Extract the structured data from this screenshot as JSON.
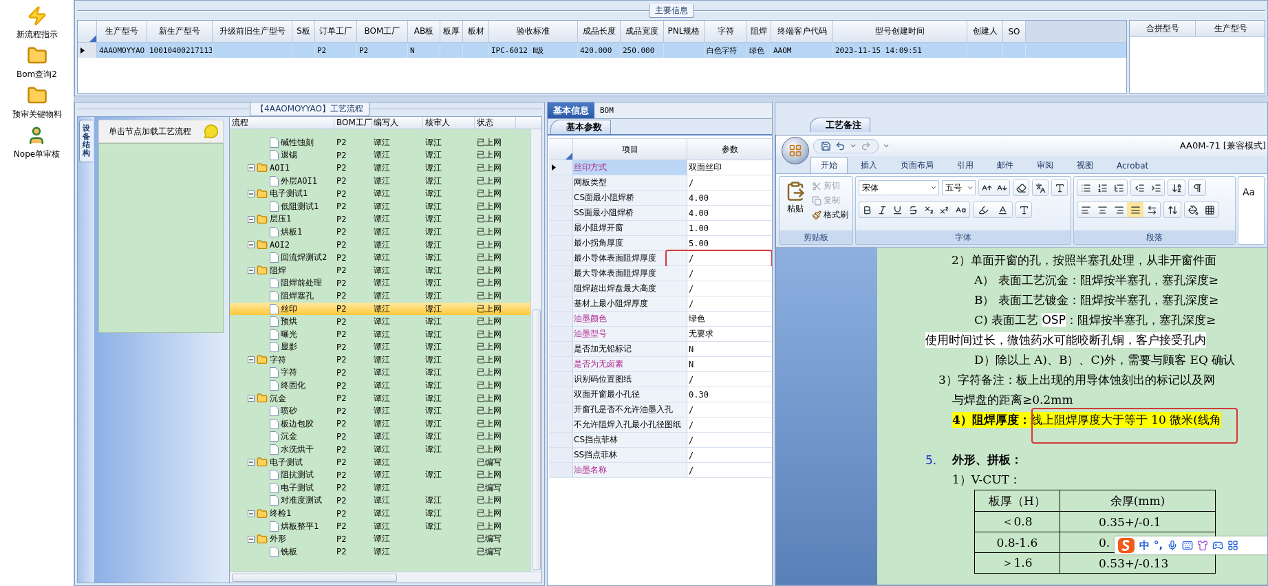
{
  "sidebar": {
    "items": [
      {
        "kind": "bolt",
        "label": "新流程指示"
      },
      {
        "kind": "folder",
        "label": "Bom查询2"
      },
      {
        "kind": "folder",
        "label": "预审关键物料"
      },
      {
        "kind": "person",
        "label": "Nope单审核"
      }
    ]
  },
  "main_info": {
    "title": "主要信息",
    "columns": [
      "生产型号",
      "新生产型号",
      "升级前旧生产型号",
      "S板",
      "订单工厂",
      "BOM工厂",
      "AB板",
      "板厚",
      "板材",
      "验收标准",
      "成品长度",
      "成品宽度",
      "PNL规格",
      "字符",
      "阻焊",
      "终端客户代码",
      "型号创建时间",
      "创建人",
      "SO"
    ],
    "rows": [
      {
        "selected": true,
        "cells": [
          "4AAOMOYYAO",
          "10010400217113",
          "",
          "",
          "P2",
          "P2",
          "N",
          "",
          "",
          "IPC-6012 Ⅱ级",
          "420.000",
          "250.000",
          "",
          "白色字符",
          "绿色",
          "AAOM",
          "2023-11-15 14:09:51",
          "",
          ""
        ]
      }
    ]
  },
  "merge_grid": {
    "columns": [
      "合拼型号",
      "生产型号"
    ]
  },
  "process": {
    "title": "【4AAOMOYYAO】工艺流程",
    "side_tab": "设备结构",
    "hint": "单击节点加载工艺流程",
    "columns": [
      "流程",
      "BOM工厂",
      "编写人",
      "核审人",
      "状态"
    ],
    "nodes": [
      {
        "children": [
          {
            "label": "碱性蚀刻",
            "bom": "P2",
            "writer": "谭江",
            "reviewer": "谭江",
            "status": "已上网",
            "selected": false
          },
          {
            "label": "退锡",
            "bom": "P2",
            "writer": "谭江",
            "reviewer": "谭江",
            "status": "已上网",
            "selected": false
          }
        ]
      },
      {
        "label": "AOI1",
        "bom": "P2",
        "writer": "谭江",
        "reviewer": "谭江",
        "status": "已上网",
        "selected": false,
        "expanded": true,
        "children": [
          {
            "label": "外层AOI1",
            "bom": "P2",
            "writer": "谭江",
            "reviewer": "谭江",
            "status": "已上网",
            "selected": false
          }
        ]
      },
      {
        "label": "电子测试1",
        "bom": "P2",
        "writer": "谭江",
        "reviewer": "谭江",
        "status": "已上网",
        "selected": false,
        "expanded": true,
        "children": [
          {
            "label": "低阻测试1",
            "bom": "P2",
            "writer": "谭江",
            "reviewer": "谭江",
            "status": "已上网",
            "selected": false
          }
        ]
      },
      {
        "label": "层压1",
        "bom": "P2",
        "writer": "谭江",
        "reviewer": "谭江",
        "status": "已上网",
        "selected": false,
        "expanded": true,
        "children": [
          {
            "label": "烘板1",
            "bom": "P2",
            "writer": "谭江",
            "reviewer": "谭江",
            "status": "已上网",
            "selected": false
          }
        ]
      },
      {
        "label": "AOI2",
        "bom": "P2",
        "writer": "谭江",
        "reviewer": "谭江",
        "status": "已上网",
        "selected": false,
        "expanded": true,
        "children": [
          {
            "label": "回流焊测试2",
            "bom": "P2",
            "writer": "谭江",
            "reviewer": "谭江",
            "status": "已上网",
            "selected": false
          }
        ]
      },
      {
        "label": "阻焊",
        "bom": "P2",
        "writer": "谭江",
        "reviewer": "谭江",
        "status": "已上网",
        "selected": false,
        "expanded": true,
        "children": [
          {
            "label": "阻焊前处理",
            "bom": "P2",
            "writer": "谭江",
            "reviewer": "谭江",
            "status": "已上网",
            "selected": false
          },
          {
            "label": "阻焊塞孔",
            "bom": "P2",
            "writer": "谭江",
            "reviewer": "谭江",
            "status": "已上网",
            "selected": false
          },
          {
            "label": "丝印",
            "bom": "P2",
            "writer": "谭江",
            "reviewer": "谭江",
            "status": "已上网",
            "selected": true
          },
          {
            "label": "预烘",
            "bom": "P2",
            "writer": "谭江",
            "reviewer": "谭江",
            "status": "已上网",
            "selected": false
          },
          {
            "label": "曝光",
            "bom": "P2",
            "writer": "谭江",
            "reviewer": "谭江",
            "status": "已上网",
            "selected": false
          },
          {
            "label": "显影",
            "bom": "P2",
            "writer": "谭江",
            "reviewer": "谭江",
            "status": "已上网",
            "selected": false
          }
        ]
      },
      {
        "label": "字符",
        "bom": "P2",
        "writer": "谭江",
        "reviewer": "谭江",
        "status": "已上网",
        "selected": false,
        "expanded": true,
        "children": [
          {
            "label": "字符",
            "bom": "P2",
            "writer": "谭江",
            "reviewer": "谭江",
            "status": "已上网",
            "selected": false
          },
          {
            "label": "终固化",
            "bom": "P2",
            "writer": "谭江",
            "reviewer": "谭江",
            "status": "已上网",
            "selected": false
          }
        ]
      },
      {
        "label": "沉金",
        "bom": "P2",
        "writer": "谭江",
        "reviewer": "谭江",
        "status": "已上网",
        "selected": false,
        "expanded": true,
        "children": [
          {
            "label": "喷砂",
            "bom": "P2",
            "writer": "谭江",
            "reviewer": "谭江",
            "status": "已上网",
            "selected": false
          },
          {
            "label": "板边包胶",
            "bom": "P2",
            "writer": "谭江",
            "reviewer": "谭江",
            "status": "已上网",
            "selected": false
          },
          {
            "label": "沉金",
            "bom": "P2",
            "writer": "谭江",
            "reviewer": "谭江",
            "status": "已上网",
            "selected": false
          },
          {
            "label": "水洗烘干",
            "bom": "P2",
            "writer": "谭江",
            "reviewer": "谭江",
            "status": "已上网",
            "selected": false
          }
        ]
      },
      {
        "label": "电子测试",
        "bom": "P2",
        "writer": "谭江",
        "status": "已编写",
        "selected": false,
        "expanded": true,
        "children": [
          {
            "label": "阻抗测试",
            "bom": "P2",
            "writer": "谭江",
            "reviewer": "谭江",
            "status": "已上网",
            "selected": false
          },
          {
            "label": "电子测试",
            "bom": "P2",
            "writer": "谭江",
            "status": "已编写",
            "selected": false
          },
          {
            "label": "对准度测试",
            "bom": "P2",
            "writer": "谭江",
            "reviewer": "谭江",
            "status": "已上网",
            "selected": false
          }
        ]
      },
      {
        "label": "终检1",
        "bom": "P2",
        "writer": "谭江",
        "reviewer": "谭江",
        "status": "已上网",
        "selected": false,
        "expanded": true,
        "children": [
          {
            "label": "烘板整平1",
            "bom": "P2",
            "writer": "谭江",
            "reviewer": "谭江",
            "status": "已上网",
            "selected": false
          }
        ]
      },
      {
        "label": "外形",
        "bom": "P2",
        "writer": "谭江",
        "status": "已编写",
        "selected": false,
        "expanded": true,
        "children": [
          {
            "label": "铣板",
            "bom": "P2",
            "writer": "谭江",
            "status": "已编写",
            "selected": false
          }
        ]
      }
    ]
  },
  "params": {
    "tabs": [
      {
        "label": "基本信息",
        "selected": true
      },
      {
        "label": "BOM",
        "selected": false
      }
    ],
    "subtab": "基本参数",
    "columns": [
      "项目",
      "参数"
    ],
    "rows": [
      {
        "label": "丝印方式",
        "value": "双面丝印",
        "emphasis": true,
        "selected": true,
        "flagged": false
      },
      {
        "label": "网板类型",
        "value": "/",
        "emphasis": false,
        "selected": false,
        "flagged": false
      },
      {
        "label": "CS面最小阻焊桥",
        "value": "4.00",
        "emphasis": false,
        "selected": false,
        "flagged": false
      },
      {
        "label": "SS面最小阻焊桥",
        "value": "4.00",
        "emphasis": false,
        "selected": false,
        "flagged": false
      },
      {
        "label": "最小阻焊开窗",
        "value": "1.00",
        "emphasis": false,
        "selected": false,
        "flagged": false
      },
      {
        "label": "最小拐角厚度",
        "value": "5.00",
        "emphasis": false,
        "selected": false,
        "flagged": false
      },
      {
        "label": "最小导体表面阻焊厚度",
        "value": "/",
        "emphasis": false,
        "selected": false,
        "flagged": true
      },
      {
        "label": "最大导体表面阻焊厚度",
        "value": "/",
        "emphasis": false,
        "selected": false,
        "flagged": false
      },
      {
        "label": "阻焊超出焊盘最大高度",
        "value": "/",
        "emphasis": false,
        "selected": false,
        "flagged": false
      },
      {
        "label": "基材上最小阻焊厚度",
        "value": "/",
        "emphasis": false,
        "selected": false,
        "flagged": false
      },
      {
        "label": "油墨颜色",
        "value": "绿色",
        "emphasis": true,
        "selected": false,
        "flagged": false
      },
      {
        "label": "油墨型号",
        "value": "无要求",
        "emphasis": true,
        "selected": false,
        "flagged": false
      },
      {
        "label": "是否加无铅标记",
        "value": "N",
        "emphasis": false,
        "selected": false,
        "flagged": false
      },
      {
        "label": "是否为无卤素",
        "value": "N",
        "emphasis": true,
        "selected": false,
        "flagged": false
      },
      {
        "label": "识别码位置图纸",
        "value": "/",
        "emphasis": false,
        "selected": false,
        "flagged": false
      },
      {
        "label": "双面开窗最小孔径",
        "value": "0.30",
        "emphasis": false,
        "selected": false,
        "flagged": false
      },
      {
        "label": "开窗孔是否不允许油墨入孔",
        "value": "/",
        "emphasis": false,
        "selected": false,
        "flagged": false
      },
      {
        "label": "不允许阻焊入孔最小孔径图纸",
        "value": "/",
        "emphasis": false,
        "selected": false,
        "flagged": false
      },
      {
        "label": "CS挡点菲林",
        "value": "/",
        "emphasis": false,
        "selected": false,
        "flagged": false
      },
      {
        "label": "SS挡点菲林",
        "value": "/",
        "emphasis": false,
        "selected": false,
        "flagged": false
      },
      {
        "label": "油墨名称",
        "value": "/",
        "emphasis": true,
        "selected": false,
        "flagged": false
      }
    ]
  },
  "notes": {
    "tab": "工艺备注"
  },
  "word": {
    "title": "AA0M-71 [兼容模式]",
    "tabs": [
      {
        "label": "开始",
        "selected": true
      },
      {
        "label": "插入",
        "selected": false
      },
      {
        "label": "页面布局",
        "selected": false
      },
      {
        "label": "引用",
        "selected": false
      },
      {
        "label": "邮件",
        "selected": false
      },
      {
        "label": "审阅",
        "selected": false
      },
      {
        "label": "视图",
        "selected": false
      },
      {
        "label": "Acrobat",
        "selected": false
      }
    ],
    "clipboard": {
      "paste": "粘贴",
      "items": [
        {
          "kind": "cut",
          "label": "剪切",
          "disabled": true
        },
        {
          "kind": "copy",
          "label": "复制",
          "disabled": true
        },
        {
          "kind": "brush",
          "label": "格式刷",
          "disabled": false
        }
      ]
    },
    "font": {
      "name": "宋体",
      "size": "五号"
    },
    "groups": [
      "剪贴板",
      "字体",
      "段落"
    ],
    "styles_preview": "Aa",
    "lines": [
      {
        "kind": "item",
        "text": "2）单面开窗的孔，按照半塞孔处理，从非开窗件面"
      },
      {
        "kind": "sub",
        "text": "A）  表面工艺沉金：阻焊按半塞孔，塞孔深度≥"
      },
      {
        "kind": "sub",
        "text": "B）  表面工艺镀金：阻焊按半塞孔，塞孔深度≥"
      },
      {
        "kind": "sub",
        "segments": [
          {
            "text": "C)   表面工艺 "
          },
          {
            "text": "OSP",
            "color": "#ffffff"
          },
          {
            "text": "：阻焊按半塞孔，塞孔深度≥"
          }
        ]
      },
      {
        "kind": "wrap",
        "text": "使用时间过长，微蚀药水可能咬断孔铜，客户接受孔内",
        "color": "#ffffff"
      },
      {
        "kind": "sub",
        "text": "D）除以上 A)、B）、C)外，需要与顾客 EQ 确认"
      },
      {
        "kind": "note",
        "text": "3）字符备注：板上出现的用导体蚀刻出的标记以及网"
      },
      {
        "kind": "cont",
        "text": "与焊盘的距离≥0.2mm"
      },
      {
        "kind": "cont",
        "text": "**4）阻焊厚度：**线上阻焊厚度大于等于 10 微米(线角",
        "color": "#ffff00",
        "flagged": true
      },
      {
        "kind": "blank"
      },
      {
        "kind": "heading",
        "number": "5.",
        "text": "外形、拼板："
      },
      {
        "kind": "cont",
        "text": "1）V-CUT："
      }
    ],
    "table": {
      "header": [
        "板厚（H）",
        "余厚(mm)"
      ],
      "rows": [
        [
          "＜0.8",
          "0.35+/-0.1"
        ],
        [
          "0.8-1.6",
          "0."
        ],
        [
          "＞1.6",
          "0.53+/-0.13"
        ]
      ]
    },
    "ime": {
      "mode": "中",
      "punct": "°,"
    }
  }
}
